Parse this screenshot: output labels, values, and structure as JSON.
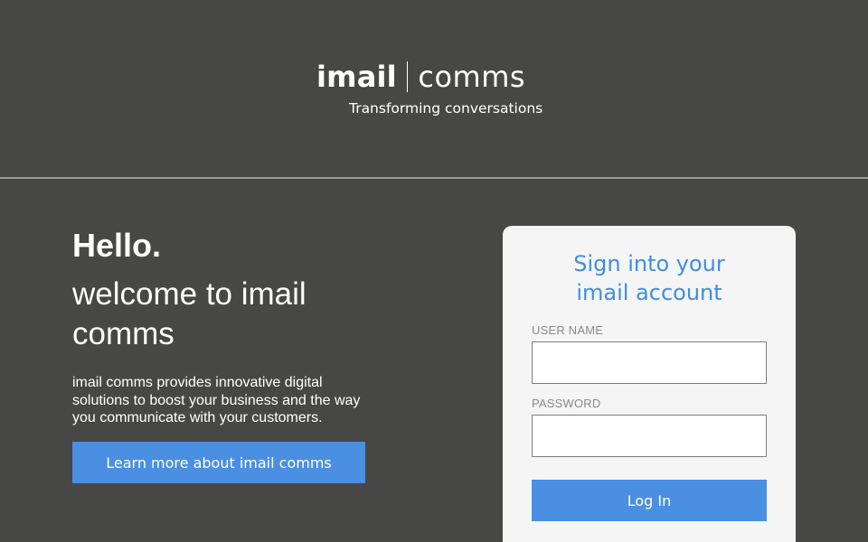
{
  "brand": {
    "name_bold": "imail",
    "name_light": "comms",
    "tagline": "Transforming conversations"
  },
  "intro": {
    "greeting": "Hello.",
    "welcome": "welcome to imail comms",
    "description": "imail comms provides innovative digital solutions to boost your business and the way you communicate with your customers.",
    "learn_more_label": "Learn more about imail comms"
  },
  "login": {
    "title_line1": "Sign into your",
    "title_line2": "imail account",
    "username_label": "USER NAME",
    "username_value": "",
    "password_label": "PASSWORD",
    "password_value": "",
    "submit_label": "Log In"
  },
  "colors": {
    "background": "#474745",
    "accent": "#4a8fe2",
    "card": "#f5f5f5",
    "title": "#3f8ee0"
  }
}
